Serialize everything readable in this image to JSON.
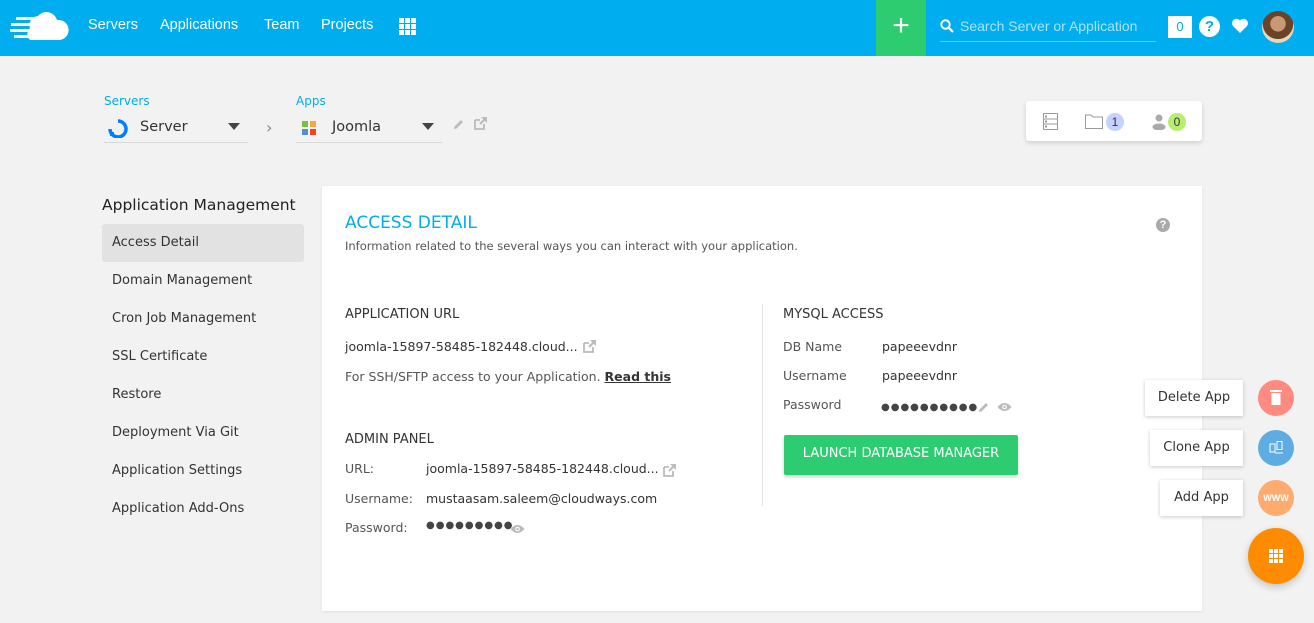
{
  "topbar": {
    "nav": [
      "Servers",
      "Applications",
      "Team",
      "Projects"
    ],
    "add_label": "+",
    "search_placeholder": "Search Server or Application",
    "notification_count": "0",
    "help_label": "?",
    "brand_color": "#00aeef",
    "add_color": "#2ecc71"
  },
  "breadcrumb": {
    "servers_label": "Servers",
    "server_name": "Server",
    "apps_label": "Apps",
    "app_name": "Joomla"
  },
  "stats": {
    "folder_count": "1",
    "user_count": "0"
  },
  "sidebar": {
    "title": "Application Management",
    "items": [
      {
        "label": "Access Detail",
        "active": true
      },
      {
        "label": "Domain Management"
      },
      {
        "label": "Cron Job Management"
      },
      {
        "label": "SSL Certificate"
      },
      {
        "label": "Restore"
      },
      {
        "label": "Deployment Via Git"
      },
      {
        "label": "Application Settings"
      },
      {
        "label": "Application Add-Ons"
      }
    ]
  },
  "main": {
    "title": "ACCESS DETAIL",
    "subtitle": "Information related to the several ways you can interact with your application.",
    "help_label": "?",
    "app_url": {
      "heading": "APPLICATION URL",
      "url": "joomla-15897-58485-182448.cloud...",
      "ssh_text": "For SSH/SFTP access to your Application.",
      "ssh_link": "Read this"
    },
    "admin": {
      "heading": "ADMIN PANEL",
      "url_label": "URL:",
      "url": "joomla-15897-58485-182448.cloud...",
      "username_label": "Username:",
      "username": "mustaasam.saleem@cloudways.com",
      "password_label": "Password:",
      "password_mask": "●●●●●●●●●"
    },
    "mysql": {
      "heading": "MYSQL ACCESS",
      "db_name_label": "DB Name",
      "db_name": "papeeevdnr",
      "username_label": "Username",
      "username": "papeeevdnr",
      "password_label": "Password",
      "password_mask": "●●●●●●●●●●",
      "launch_label": "LAUNCH DATABASE MANAGER"
    }
  },
  "fab": {
    "delete_label": "Delete App",
    "clone_label": "Clone App",
    "add_label": "Add App",
    "add_icon_text": "WWW",
    "delete_color": "#ff8a80",
    "clone_color": "#5dade2",
    "add_color": "#ffab70",
    "main_color": "#ff8c00"
  }
}
